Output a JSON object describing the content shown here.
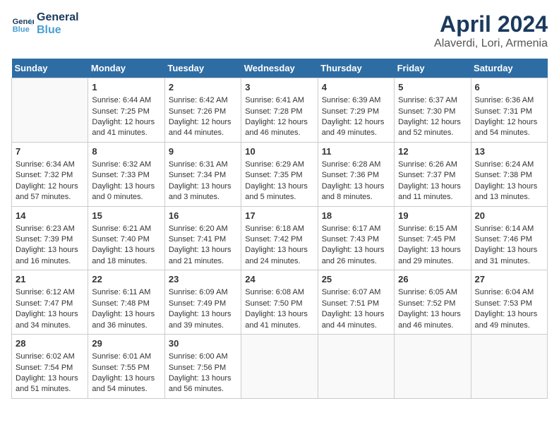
{
  "header": {
    "logo_line1": "General",
    "logo_line2": "Blue",
    "title": "April 2024",
    "subtitle": "Alaverdi, Lori, Armenia"
  },
  "days_of_week": [
    "Sunday",
    "Monday",
    "Tuesday",
    "Wednesday",
    "Thursday",
    "Friday",
    "Saturday"
  ],
  "weeks": [
    [
      {
        "day": "",
        "sunrise": "",
        "sunset": "",
        "daylight": "",
        "empty": true
      },
      {
        "day": "1",
        "sunrise": "Sunrise: 6:44 AM",
        "sunset": "Sunset: 7:25 PM",
        "daylight": "Daylight: 12 hours and 41 minutes."
      },
      {
        "day": "2",
        "sunrise": "Sunrise: 6:42 AM",
        "sunset": "Sunset: 7:26 PM",
        "daylight": "Daylight: 12 hours and 44 minutes."
      },
      {
        "day": "3",
        "sunrise": "Sunrise: 6:41 AM",
        "sunset": "Sunset: 7:28 PM",
        "daylight": "Daylight: 12 hours and 46 minutes."
      },
      {
        "day": "4",
        "sunrise": "Sunrise: 6:39 AM",
        "sunset": "Sunset: 7:29 PM",
        "daylight": "Daylight: 12 hours and 49 minutes."
      },
      {
        "day": "5",
        "sunrise": "Sunrise: 6:37 AM",
        "sunset": "Sunset: 7:30 PM",
        "daylight": "Daylight: 12 hours and 52 minutes."
      },
      {
        "day": "6",
        "sunrise": "Sunrise: 6:36 AM",
        "sunset": "Sunset: 7:31 PM",
        "daylight": "Daylight: 12 hours and 54 minutes."
      }
    ],
    [
      {
        "day": "7",
        "sunrise": "Sunrise: 6:34 AM",
        "sunset": "Sunset: 7:32 PM",
        "daylight": "Daylight: 12 hours and 57 minutes."
      },
      {
        "day": "8",
        "sunrise": "Sunrise: 6:32 AM",
        "sunset": "Sunset: 7:33 PM",
        "daylight": "Daylight: 13 hours and 0 minutes."
      },
      {
        "day": "9",
        "sunrise": "Sunrise: 6:31 AM",
        "sunset": "Sunset: 7:34 PM",
        "daylight": "Daylight: 13 hours and 3 minutes."
      },
      {
        "day": "10",
        "sunrise": "Sunrise: 6:29 AM",
        "sunset": "Sunset: 7:35 PM",
        "daylight": "Daylight: 13 hours and 5 minutes."
      },
      {
        "day": "11",
        "sunrise": "Sunrise: 6:28 AM",
        "sunset": "Sunset: 7:36 PM",
        "daylight": "Daylight: 13 hours and 8 minutes."
      },
      {
        "day": "12",
        "sunrise": "Sunrise: 6:26 AM",
        "sunset": "Sunset: 7:37 PM",
        "daylight": "Daylight: 13 hours and 11 minutes."
      },
      {
        "day": "13",
        "sunrise": "Sunrise: 6:24 AM",
        "sunset": "Sunset: 7:38 PM",
        "daylight": "Daylight: 13 hours and 13 minutes."
      }
    ],
    [
      {
        "day": "14",
        "sunrise": "Sunrise: 6:23 AM",
        "sunset": "Sunset: 7:39 PM",
        "daylight": "Daylight: 13 hours and 16 minutes."
      },
      {
        "day": "15",
        "sunrise": "Sunrise: 6:21 AM",
        "sunset": "Sunset: 7:40 PM",
        "daylight": "Daylight: 13 hours and 18 minutes."
      },
      {
        "day": "16",
        "sunrise": "Sunrise: 6:20 AM",
        "sunset": "Sunset: 7:41 PM",
        "daylight": "Daylight: 13 hours and 21 minutes."
      },
      {
        "day": "17",
        "sunrise": "Sunrise: 6:18 AM",
        "sunset": "Sunset: 7:42 PM",
        "daylight": "Daylight: 13 hours and 24 minutes."
      },
      {
        "day": "18",
        "sunrise": "Sunrise: 6:17 AM",
        "sunset": "Sunset: 7:43 PM",
        "daylight": "Daylight: 13 hours and 26 minutes."
      },
      {
        "day": "19",
        "sunrise": "Sunrise: 6:15 AM",
        "sunset": "Sunset: 7:45 PM",
        "daylight": "Daylight: 13 hours and 29 minutes."
      },
      {
        "day": "20",
        "sunrise": "Sunrise: 6:14 AM",
        "sunset": "Sunset: 7:46 PM",
        "daylight": "Daylight: 13 hours and 31 minutes."
      }
    ],
    [
      {
        "day": "21",
        "sunrise": "Sunrise: 6:12 AM",
        "sunset": "Sunset: 7:47 PM",
        "daylight": "Daylight: 13 hours and 34 minutes."
      },
      {
        "day": "22",
        "sunrise": "Sunrise: 6:11 AM",
        "sunset": "Sunset: 7:48 PM",
        "daylight": "Daylight: 13 hours and 36 minutes."
      },
      {
        "day": "23",
        "sunrise": "Sunrise: 6:09 AM",
        "sunset": "Sunset: 7:49 PM",
        "daylight": "Daylight: 13 hours and 39 minutes."
      },
      {
        "day": "24",
        "sunrise": "Sunrise: 6:08 AM",
        "sunset": "Sunset: 7:50 PM",
        "daylight": "Daylight: 13 hours and 41 minutes."
      },
      {
        "day": "25",
        "sunrise": "Sunrise: 6:07 AM",
        "sunset": "Sunset: 7:51 PM",
        "daylight": "Daylight: 13 hours and 44 minutes."
      },
      {
        "day": "26",
        "sunrise": "Sunrise: 6:05 AM",
        "sunset": "Sunset: 7:52 PM",
        "daylight": "Daylight: 13 hours and 46 minutes."
      },
      {
        "day": "27",
        "sunrise": "Sunrise: 6:04 AM",
        "sunset": "Sunset: 7:53 PM",
        "daylight": "Daylight: 13 hours and 49 minutes."
      }
    ],
    [
      {
        "day": "28",
        "sunrise": "Sunrise: 6:02 AM",
        "sunset": "Sunset: 7:54 PM",
        "daylight": "Daylight: 13 hours and 51 minutes."
      },
      {
        "day": "29",
        "sunrise": "Sunrise: 6:01 AM",
        "sunset": "Sunset: 7:55 PM",
        "daylight": "Daylight: 13 hours and 54 minutes."
      },
      {
        "day": "30",
        "sunrise": "Sunrise: 6:00 AM",
        "sunset": "Sunset: 7:56 PM",
        "daylight": "Daylight: 13 hours and 56 minutes."
      },
      {
        "day": "",
        "sunrise": "",
        "sunset": "",
        "daylight": "",
        "empty": true
      },
      {
        "day": "",
        "sunrise": "",
        "sunset": "",
        "daylight": "",
        "empty": true
      },
      {
        "day": "",
        "sunrise": "",
        "sunset": "",
        "daylight": "",
        "empty": true
      },
      {
        "day": "",
        "sunrise": "",
        "sunset": "",
        "daylight": "",
        "empty": true
      }
    ]
  ]
}
